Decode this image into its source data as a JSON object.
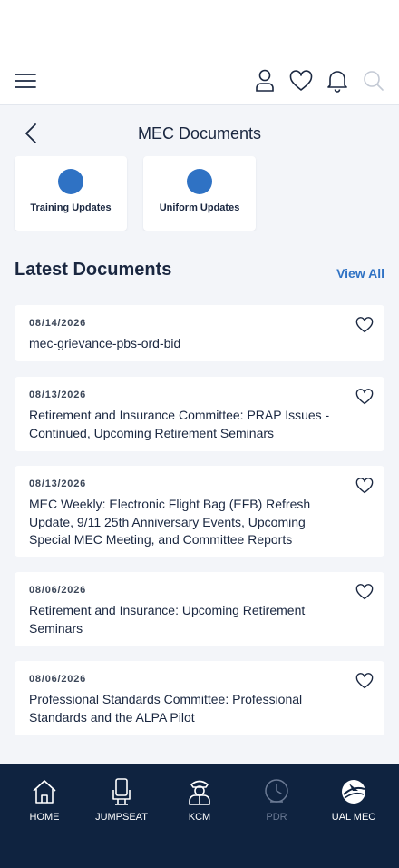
{
  "header": {
    "menu_icon": "hamburger-menu-icon",
    "profile_icon": "user-icon",
    "favorites_icon": "heart-icon",
    "notifications_icon": "bell-icon",
    "search_icon": "search-icon"
  },
  "subheader": {
    "title": "MEC Documents",
    "back_icon": "chevron-left-icon"
  },
  "categories": [
    {
      "label": "Training Updates"
    },
    {
      "label": "Uniform Updates"
    }
  ],
  "latest": {
    "title": "Latest Documents",
    "view_all": "View All"
  },
  "documents": [
    {
      "date": "08/14/2026",
      "title": "mec-grievance-pbs-ord-bid"
    },
    {
      "date": "08/13/2026",
      "title": "Retirement and Insurance Committee: PRAP Issues - Continued, Upcoming Retirement Seminars"
    },
    {
      "date": "08/13/2026",
      "title": "MEC Weekly: Electronic Flight Bag (EFB) Refresh Update, 9/11 25th Anniversary Events, Upcoming Special MEC Meeting, and Committee Reports"
    },
    {
      "date": "08/06/2026",
      "title": "Retirement and Insurance: Upcoming Retirement Seminars"
    },
    {
      "date": "08/06/2026",
      "title": "Professional Standards Committee: Professional Standards and the ALPA Pilot"
    }
  ],
  "bottom_nav": [
    {
      "label": "HOME",
      "icon": "home-icon"
    },
    {
      "label": "JUMPSEAT",
      "icon": "seat-icon"
    },
    {
      "label": "KCM",
      "icon": "pilot-icon"
    },
    {
      "label": "PDR",
      "icon": "clock-globe-icon"
    },
    {
      "label": "UAL MEC",
      "icon": "globe-logo-icon"
    }
  ],
  "colors": {
    "accent": "#2f72c4",
    "nav_background": "#0f2340",
    "page_background": "#f3f5f9"
  }
}
